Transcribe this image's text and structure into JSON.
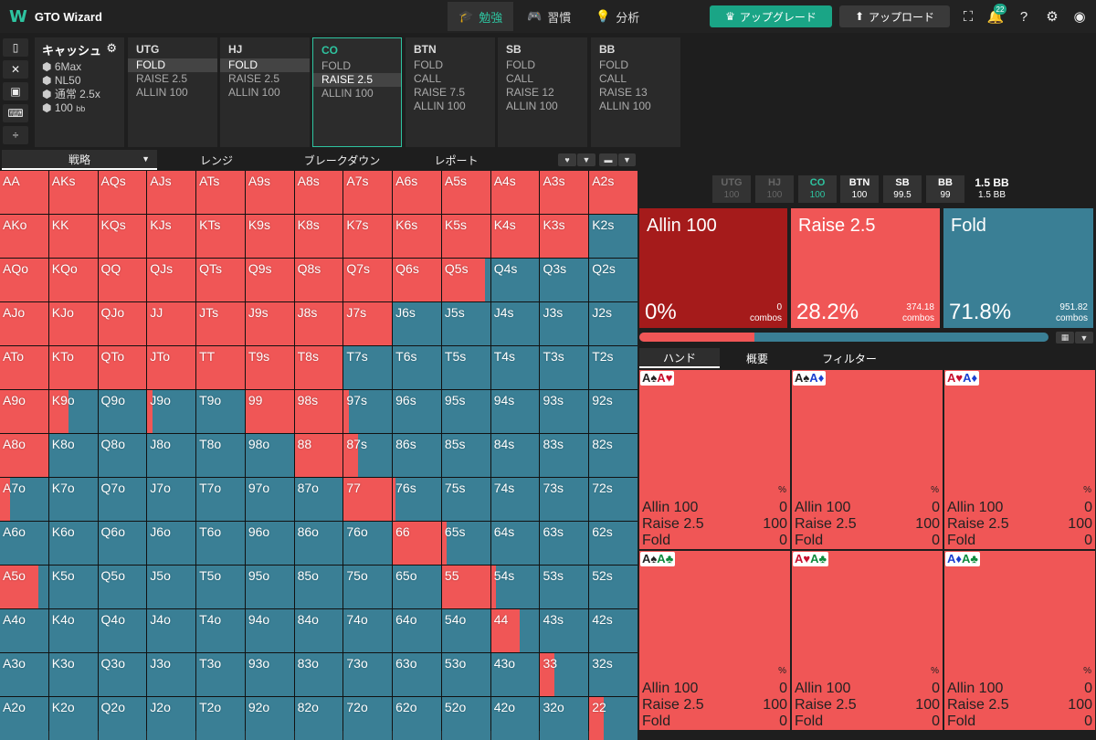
{
  "app": {
    "logo": "W",
    "title": "GTO Wizard"
  },
  "nav": [
    {
      "label": "勉強",
      "icon": "mortarboard-icon"
    },
    {
      "label": "習慣",
      "icon": "gamepad-icon"
    },
    {
      "label": "分析",
      "icon": "lightbulb-icon"
    }
  ],
  "buttons": {
    "upgrade": "アップグレード",
    "upload": "アップロード"
  },
  "notifications": "22",
  "game": {
    "title": "キャッシュ",
    "format": "6Max",
    "stakes": "NL50",
    "rake": "通常 2.5x",
    "stack": "100",
    "stack_unit": "bb"
  },
  "positions": [
    {
      "name": "UTG",
      "actions": [
        "FOLD",
        "RAISE 2.5",
        "ALLIN 100"
      ],
      "sel": 0
    },
    {
      "name": "HJ",
      "actions": [
        "FOLD",
        "RAISE 2.5",
        "ALLIN 100"
      ],
      "sel": 0
    },
    {
      "name": "CO",
      "actions": [
        "FOLD",
        "RAISE 2.5",
        "ALLIN 100"
      ],
      "sel": 1
    },
    {
      "name": "BTN",
      "actions": [
        "FOLD",
        "CALL",
        "RAISE 7.5",
        "ALLIN 100"
      ],
      "sel": -1
    },
    {
      "name": "SB",
      "actions": [
        "FOLD",
        "CALL",
        "RAISE 12",
        "ALLIN 100"
      ],
      "sel": -1
    },
    {
      "name": "BB",
      "actions": [
        "FOLD",
        "CALL",
        "RAISE 13",
        "ALLIN 100"
      ],
      "sel": -1
    }
  ],
  "subtabs": [
    "戦略",
    "レンジ",
    "ブレークダウン",
    "レポート"
  ],
  "hands": [
    [
      "AA",
      "AKs",
      "AQs",
      "AJs",
      "ATs",
      "A9s",
      "A8s",
      "A7s",
      "A6s",
      "A5s",
      "A4s",
      "A3s",
      "A2s"
    ],
    [
      "AKo",
      "KK",
      "KQs",
      "KJs",
      "KTs",
      "K9s",
      "K8s",
      "K7s",
      "K6s",
      "K5s",
      "K4s",
      "K3s",
      "K2s"
    ],
    [
      "AQo",
      "KQo",
      "QQ",
      "QJs",
      "QTs",
      "Q9s",
      "Q8s",
      "Q7s",
      "Q6s",
      "Q5s",
      "Q4s",
      "Q3s",
      "Q2s"
    ],
    [
      "AJo",
      "KJo",
      "QJo",
      "JJ",
      "JTs",
      "J9s",
      "J8s",
      "J7s",
      "J6s",
      "J5s",
      "J4s",
      "J3s",
      "J2s"
    ],
    [
      "ATo",
      "KTo",
      "QTo",
      "JTo",
      "TT",
      "T9s",
      "T8s",
      "T7s",
      "T6s",
      "T5s",
      "T4s",
      "T3s",
      "T2s"
    ],
    [
      "A9o",
      "K9o",
      "Q9o",
      "J9o",
      "T9o",
      "99",
      "98s",
      "97s",
      "96s",
      "95s",
      "94s",
      "93s",
      "92s"
    ],
    [
      "A8o",
      "K8o",
      "Q8o",
      "J8o",
      "T8o",
      "98o",
      "88",
      "87s",
      "86s",
      "85s",
      "84s",
      "83s",
      "82s"
    ],
    [
      "A7o",
      "K7o",
      "Q7o",
      "J7o",
      "T7o",
      "97o",
      "87o",
      "77",
      "76s",
      "75s",
      "74s",
      "73s",
      "72s"
    ],
    [
      "A6o",
      "K6o",
      "Q6o",
      "J6o",
      "T6o",
      "96o",
      "86o",
      "76o",
      "66",
      "65s",
      "64s",
      "63s",
      "62s"
    ],
    [
      "A5o",
      "K5o",
      "Q5o",
      "J5o",
      "T5o",
      "95o",
      "85o",
      "75o",
      "65o",
      "55",
      "54s",
      "53s",
      "52s"
    ],
    [
      "A4o",
      "K4o",
      "Q4o",
      "J4o",
      "T4o",
      "94o",
      "84o",
      "74o",
      "64o",
      "54o",
      "44",
      "43s",
      "42s"
    ],
    [
      "A3o",
      "K3o",
      "Q3o",
      "J3o",
      "T3o",
      "93o",
      "83o",
      "73o",
      "63o",
      "53o",
      "43o",
      "33",
      "32s"
    ],
    [
      "A2o",
      "K2o",
      "Q2o",
      "J2o",
      "T2o",
      "92o",
      "82o",
      "72o",
      "62o",
      "52o",
      "42o",
      "32o",
      "22"
    ]
  ],
  "raise_freq": [
    [
      1,
      1,
      1,
      1,
      1,
      1,
      1,
      1,
      1,
      1,
      1,
      1,
      1
    ],
    [
      1,
      1,
      1,
      1,
      1,
      1,
      1,
      1,
      1,
      1,
      1,
      1,
      0
    ],
    [
      1,
      1,
      1,
      1,
      1,
      1,
      1,
      1,
      1,
      0.9,
      0,
      0,
      0
    ],
    [
      1,
      1,
      1,
      1,
      1,
      1,
      1,
      1,
      0,
      0,
      0,
      0,
      0
    ],
    [
      1,
      1,
      1,
      1,
      1,
      1,
      1,
      0,
      0,
      0,
      0,
      0,
      0
    ],
    [
      1,
      0.4,
      0,
      0.1,
      0,
      1,
      1,
      0.1,
      0,
      0,
      0,
      0,
      0
    ],
    [
      1,
      0,
      0,
      0,
      0,
      0,
      1,
      0.3,
      0,
      0,
      0,
      0,
      0
    ],
    [
      0.2,
      0,
      0,
      0,
      0,
      0,
      0,
      1,
      0.05,
      0,
      0,
      0,
      0
    ],
    [
      0,
      0,
      0,
      0,
      0,
      0,
      0,
      0,
      1,
      0.1,
      0,
      0,
      0
    ],
    [
      0.8,
      0,
      0,
      0,
      0,
      0,
      0,
      0,
      0,
      1,
      0.1,
      0,
      0
    ],
    [
      0,
      0,
      0,
      0,
      0,
      0,
      0,
      0,
      0,
      0,
      0.6,
      0,
      0
    ],
    [
      0,
      0,
      0,
      0,
      0,
      0,
      0,
      0,
      0,
      0,
      0,
      0.3,
      0
    ],
    [
      0,
      0,
      0,
      0,
      0,
      0,
      0,
      0,
      0,
      0,
      0,
      0,
      0.3
    ]
  ],
  "players": [
    {
      "pos": "UTG",
      "stack": "100"
    },
    {
      "pos": "HJ",
      "stack": "100"
    },
    {
      "pos": "CO",
      "stack": "100"
    },
    {
      "pos": "BTN",
      "stack": "100"
    },
    {
      "pos": "SB",
      "stack": "99.5"
    },
    {
      "pos": "BB",
      "stack": "99"
    }
  ],
  "pot": {
    "main": "1.5 BB",
    "sub": "1.5 BB"
  },
  "summary": [
    {
      "name": "Allin 100",
      "pct": "0%",
      "combos": "0",
      "color": "#a51b1b"
    },
    {
      "name": "Raise 2.5",
      "pct": "28.2%",
      "combos": "374.18",
      "color": "#f05656"
    },
    {
      "name": "Fold",
      "pct": "71.8%",
      "combos": "951.82",
      "color": "#3a7f95"
    }
  ],
  "combos_label": "combos",
  "raise_total": 0.282,
  "righttabs": [
    "ハンド",
    "概要",
    "フィルター"
  ],
  "combo_cells": [
    {
      "c1": "A",
      "s1": "♠",
      "k1": "blk",
      "c2": "A",
      "s2": "♥",
      "k2": "red"
    },
    {
      "c1": "A",
      "s1": "♠",
      "k1": "blk",
      "c2": "A",
      "s2": "♦",
      "k2": "blu"
    },
    {
      "c1": "A",
      "s1": "♥",
      "k1": "red",
      "c2": "A",
      "s2": "♦",
      "k2": "blu"
    },
    {
      "c1": "A",
      "s1": "♠",
      "k1": "blk",
      "c2": "A",
      "s2": "♣",
      "k2": "grn"
    },
    {
      "c1": "A",
      "s1": "♥",
      "k1": "red",
      "c2": "A",
      "s2": "♣",
      "k2": "grn"
    },
    {
      "c1": "A",
      "s1": "♦",
      "k1": "blu",
      "c2": "A",
      "s2": "♣",
      "k2": "grn"
    }
  ],
  "combo_rows": [
    {
      "name": "Allin 100",
      "val": "0"
    },
    {
      "name": "Raise 2.5",
      "val": "100"
    },
    {
      "name": "Fold",
      "val": "0"
    }
  ],
  "pct_sign": "%"
}
